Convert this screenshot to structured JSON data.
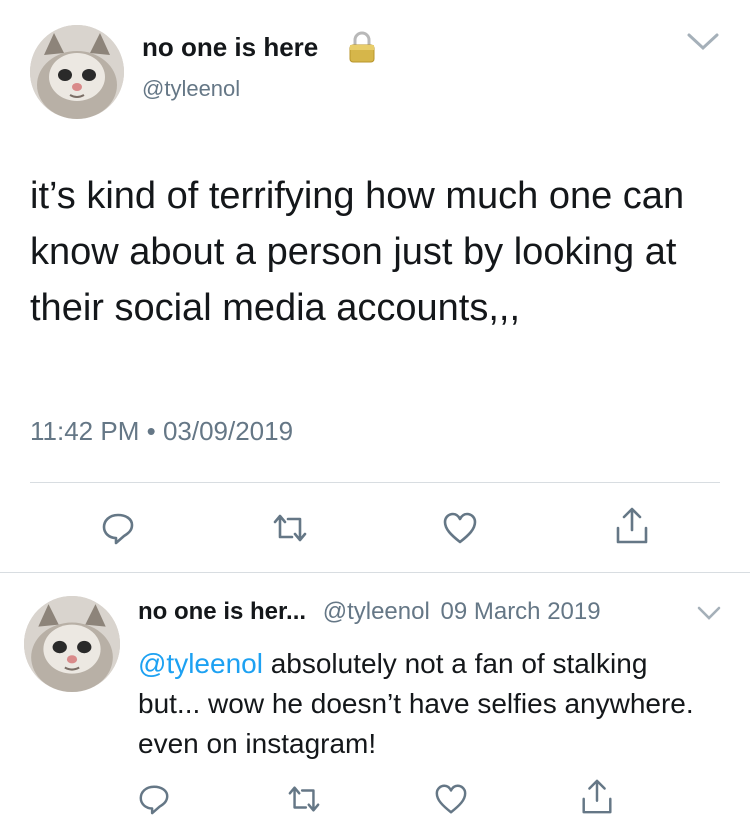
{
  "colors": {
    "text": "#14171a",
    "secondary": "#657786",
    "link": "#1da1f2",
    "divider": "#d8dde1",
    "lock": "#d6b64a"
  },
  "main_tweet": {
    "display_name": "no one is here",
    "handle": "@tyleenol",
    "text": "it’s kind of terrifying how much one can know about a person just by looking at their social media accounts,,,",
    "time": "11:42 PM",
    "dot": "•",
    "date": "03/09/2019",
    "icons": [
      "lock-icon",
      "chevron-down-icon",
      "reply-icon",
      "retweet-icon",
      "like-icon",
      "share-icon"
    ]
  },
  "reply_tweet": {
    "display_name": "no one is her...",
    "handle": "@tyleenol",
    "date": "09 March 2019",
    "mention": "@tyleenol",
    "text": " absolutely not a fan of stalking but... wow he doesn’t have selfies anywhere. even on instagram!",
    "icons": [
      "chevron-down-icon",
      "reply-icon",
      "retweet-icon",
      "like-icon",
      "share-icon"
    ]
  }
}
